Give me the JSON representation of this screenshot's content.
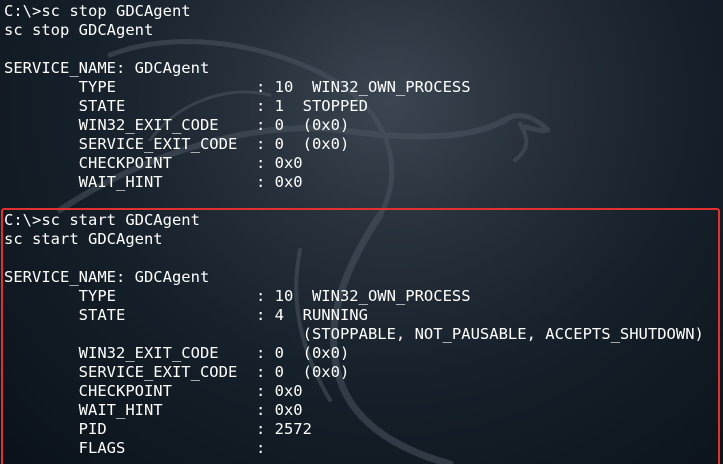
{
  "theme": {
    "background": "#16202a",
    "text": "#ffffff",
    "highlight_border": "#e0312e"
  },
  "watermark_icon": "kali-dragon-icon",
  "stop_block": {
    "prompt": "C:\\>sc stop GDCAgent",
    "echo": "sc stop GDCAgent",
    "service_name": "SERVICE_NAME: GDCAgent",
    "type": "        TYPE               : 10  WIN32_OWN_PROCESS",
    "state": "        STATE              : 1  STOPPED",
    "win32_exit_code": "        WIN32_EXIT_CODE    : 0  (0x0)",
    "service_exit_code": "        SERVICE_EXIT_CODE  : 0  (0x0)",
    "checkpoint": "        CHECKPOINT         : 0x0",
    "wait_hint": "        WAIT_HINT          : 0x0"
  },
  "start_block": {
    "prompt": "C:\\>sc start GDCAgent",
    "echo": "sc start GDCAgent",
    "service_name": "SERVICE_NAME: GDCAgent",
    "type": "        TYPE               : 10  WIN32_OWN_PROCESS",
    "state": "        STATE              : 4  RUNNING",
    "state_flags": "                                (STOPPABLE, NOT_PAUSABLE, ACCEPTS_SHUTDOWN)",
    "win32_exit_code": "        WIN32_EXIT_CODE    : 0  (0x0)",
    "service_exit_code": "        SERVICE_EXIT_CODE  : 0  (0x0)",
    "checkpoint": "        CHECKPOINT         : 0x0",
    "wait_hint": "        WAIT_HINT          : 0x0",
    "pid": "        PID                : 2572",
    "flags": "        FLAGS              :"
  }
}
